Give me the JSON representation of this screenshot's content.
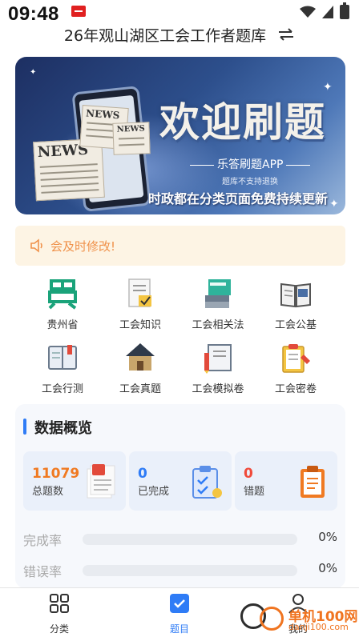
{
  "status_bar": {
    "time": "09:48"
  },
  "header": {
    "title": "26年观山湖区工会工作者题库"
  },
  "banner": {
    "heading": "欢迎刷题",
    "app_name": "乐答刷题APP",
    "note": "题库不支持退换",
    "slogan": "时政都在分类页面免费持续更新",
    "news_label": "NEWS"
  },
  "notice": {
    "text": "会及时修改!"
  },
  "categories": [
    {
      "label": "贵州省",
      "icon": "gui-character-icon"
    },
    {
      "label": "工会知识",
      "icon": "checklist-document-icon"
    },
    {
      "label": "工会相关法",
      "icon": "stacked-books-icon"
    },
    {
      "label": "工会公基",
      "icon": "open-book-icon"
    },
    {
      "label": "工会行测",
      "icon": "notebook-icon"
    },
    {
      "label": "工会真题",
      "icon": "house-icon"
    },
    {
      "label": "工会模拟卷",
      "icon": "pencil-book-icon"
    },
    {
      "label": "工会密卷",
      "icon": "clipboard-pencil-icon"
    }
  ],
  "overview": {
    "title": "数据概览",
    "stats": [
      {
        "value": "11079",
        "label": "总题数",
        "color": "#f07a22"
      },
      {
        "value": "0",
        "label": "已完成",
        "color": "#2f7cf6"
      },
      {
        "value": "0",
        "label": "错题",
        "color": "#f04a3a"
      }
    ],
    "rates": [
      {
        "label": "完成率",
        "value": "0%",
        "fraction": 0
      },
      {
        "label": "错误率",
        "value": "0%",
        "fraction": 0
      }
    ]
  },
  "tabbar": {
    "tabs": [
      {
        "label": "分类",
        "icon": "grid-icon",
        "active": false
      },
      {
        "label": "题目",
        "icon": "checkbox-icon",
        "active": true
      },
      {
        "label": "我的",
        "icon": "person-icon",
        "active": false
      }
    ]
  },
  "watermark": {
    "text": "单机100网",
    "url": "danji100.com"
  },
  "colors": {
    "accent": "#2f7cf6",
    "notice_text": "#f0924b",
    "notice_bg": "#fdf4e4"
  }
}
